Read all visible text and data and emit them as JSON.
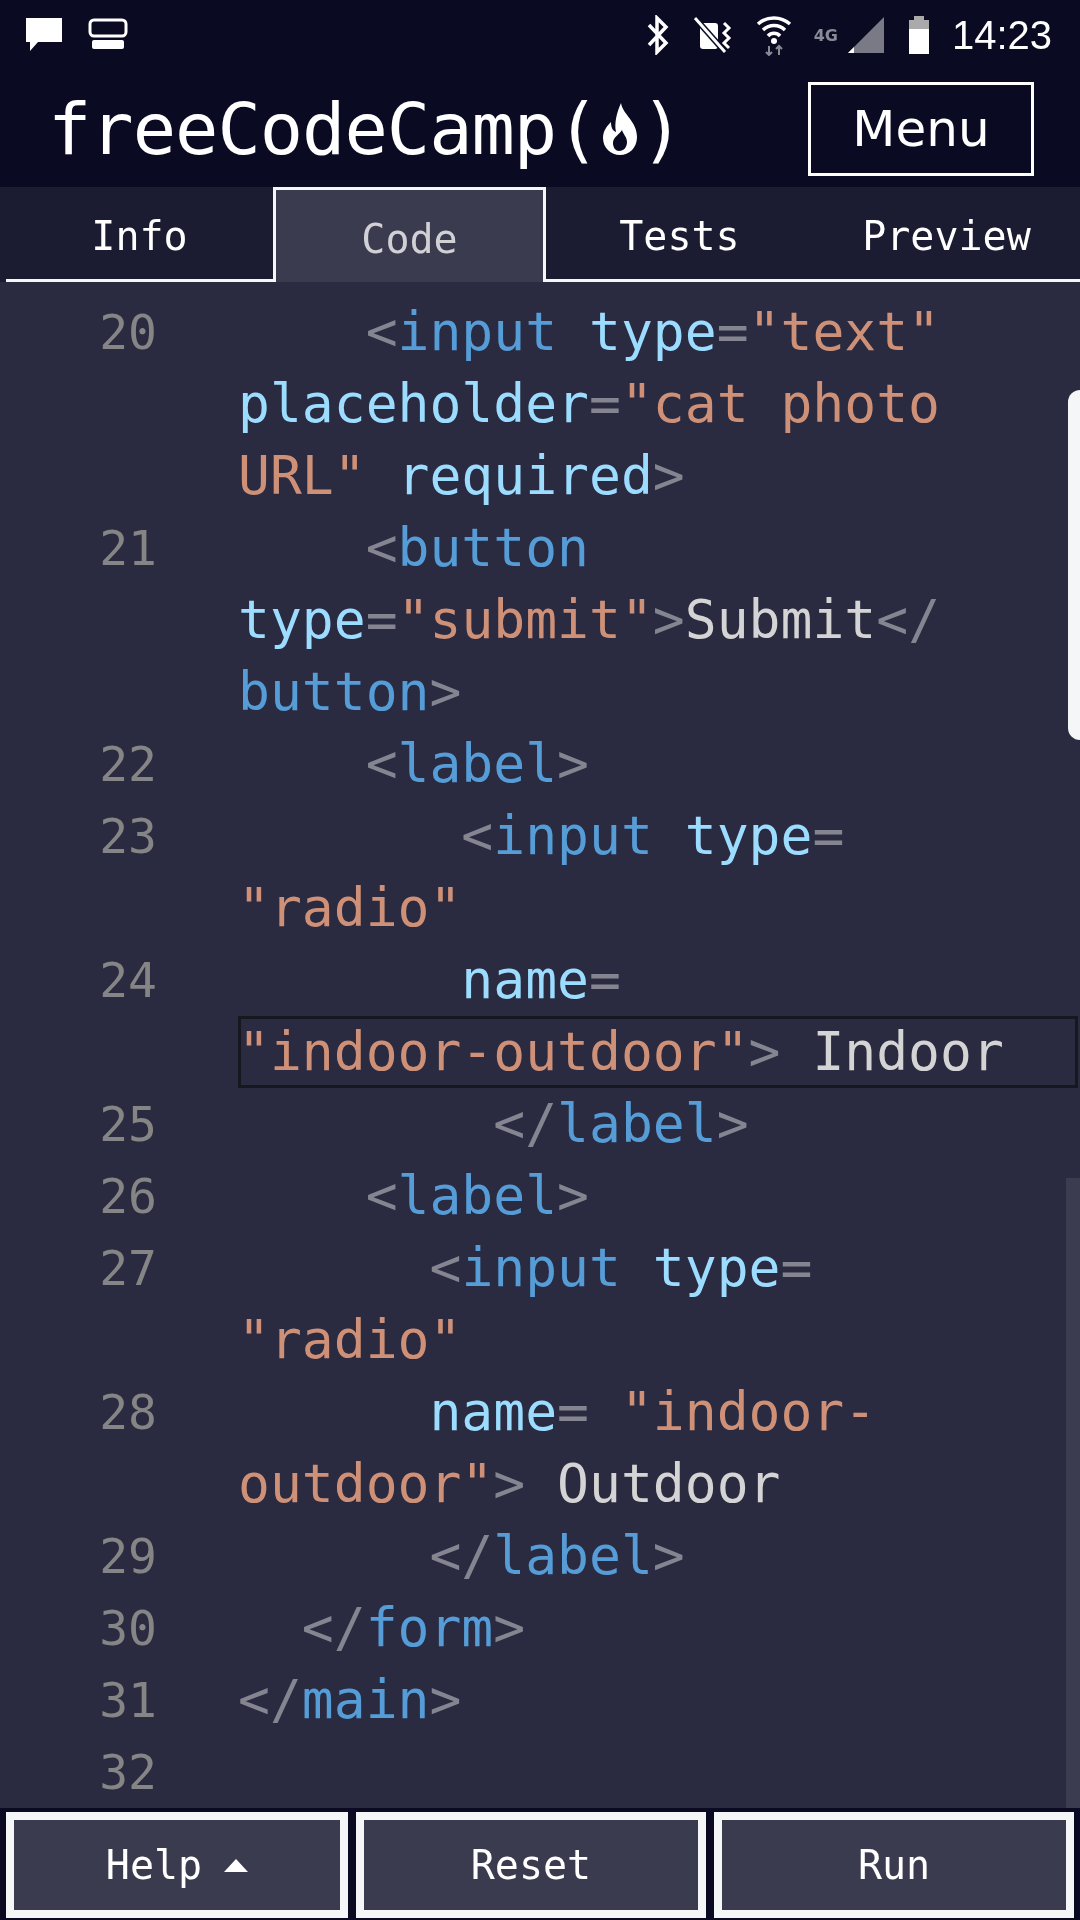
{
  "status_bar": {
    "network": "4G",
    "time": "14:23"
  },
  "header": {
    "brand": "freeCodeCamp",
    "open_paren": "(",
    "close_paren": ")",
    "menu_button": "Menu"
  },
  "tabs": [
    {
      "label": "Info",
      "selected": false
    },
    {
      "label": "Code",
      "selected": true
    },
    {
      "label": "Tests",
      "selected": false
    },
    {
      "label": "Preview",
      "selected": false
    }
  ],
  "editor": {
    "lines": [
      {
        "number": "20",
        "highlighted": false,
        "rows": [
          {
            "tokens": [
              {
                "kind": "punct",
                "text": "    <"
              },
              {
                "kind": "tag",
                "text": "input"
              },
              {
                "kind": "attr",
                "text": " type"
              },
              {
                "kind": "punct",
                "text": "="
              },
              {
                "kind": "string",
                "text": "\"text\""
              }
            ]
          },
          {
            "tokens": [
              {
                "kind": "attr",
                "text": "placeholder"
              },
              {
                "kind": "punct",
                "text": "="
              },
              {
                "kind": "string",
                "text": "\"cat photo"
              }
            ]
          },
          {
            "tokens": [
              {
                "kind": "string",
                "text": "URL\""
              },
              {
                "kind": "attr",
                "text": " required"
              },
              {
                "kind": "punct",
                "text": ">"
              }
            ]
          }
        ]
      },
      {
        "number": "21",
        "highlighted": false,
        "rows": [
          {
            "tokens": [
              {
                "kind": "punct",
                "text": "    <"
              },
              {
                "kind": "tag",
                "text": "button"
              }
            ]
          },
          {
            "tokens": [
              {
                "kind": "attr",
                "text": "type"
              },
              {
                "kind": "punct",
                "text": "="
              },
              {
                "kind": "string",
                "text": "\"submit\""
              },
              {
                "kind": "punct",
                "text": ">"
              },
              {
                "kind": "text",
                "text": "Submit"
              },
              {
                "kind": "punct",
                "text": "</"
              }
            ]
          },
          {
            "tokens": [
              {
                "kind": "tag",
                "text": "button"
              },
              {
                "kind": "punct",
                "text": ">"
              }
            ]
          }
        ]
      },
      {
        "number": "22",
        "highlighted": false,
        "rows": [
          {
            "tokens": [
              {
                "kind": "punct",
                "text": "    <"
              },
              {
                "kind": "tag",
                "text": "label"
              },
              {
                "kind": "punct",
                "text": ">"
              }
            ]
          }
        ]
      },
      {
        "number": "23",
        "highlighted": false,
        "rows": [
          {
            "tokens": [
              {
                "kind": "punct",
                "text": "       <"
              },
              {
                "kind": "tag",
                "text": "input"
              },
              {
                "kind": "attr",
                "text": " type"
              },
              {
                "kind": "punct",
                "text": "="
              }
            ]
          },
          {
            "tokens": [
              {
                "kind": "string",
                "text": "\"radio\""
              }
            ]
          }
        ]
      },
      {
        "number": "24",
        "highlighted": true,
        "rows": [
          {
            "tokens": [
              {
                "kind": "attr",
                "text": "       name"
              },
              {
                "kind": "punct",
                "text": "="
              }
            ]
          },
          {
            "tokens": [
              {
                "kind": "string",
                "text": "\"indoor-outdoor\""
              },
              {
                "kind": "punct",
                "text": ">"
              },
              {
                "kind": "text",
                "text": " Indoor"
              }
            ]
          }
        ]
      },
      {
        "number": "25",
        "highlighted": false,
        "rows": [
          {
            "tokens": [
              {
                "kind": "punct",
                "text": "        </"
              },
              {
                "kind": "tag",
                "text": "label"
              },
              {
                "kind": "punct",
                "text": ">"
              }
            ]
          }
        ]
      },
      {
        "number": "26",
        "highlighted": false,
        "rows": [
          {
            "tokens": [
              {
                "kind": "punct",
                "text": "    <"
              },
              {
                "kind": "tag",
                "text": "label"
              },
              {
                "kind": "punct",
                "text": ">"
              }
            ]
          }
        ]
      },
      {
        "number": "27",
        "highlighted": false,
        "rows": [
          {
            "tokens": [
              {
                "kind": "punct",
                "text": "      <"
              },
              {
                "kind": "tag",
                "text": "input"
              },
              {
                "kind": "attr",
                "text": " type"
              },
              {
                "kind": "punct",
                "text": "="
              }
            ]
          },
          {
            "tokens": [
              {
                "kind": "string",
                "text": "\"radio\""
              }
            ]
          }
        ]
      },
      {
        "number": "28",
        "highlighted": false,
        "rows": [
          {
            "tokens": [
              {
                "kind": "attr",
                "text": "      name"
              },
              {
                "kind": "punct",
                "text": "= "
              },
              {
                "kind": "string",
                "text": "\"indoor-"
              }
            ]
          },
          {
            "tokens": [
              {
                "kind": "string",
                "text": "outdoor\""
              },
              {
                "kind": "punct",
                "text": ">"
              },
              {
                "kind": "text",
                "text": " Outdoor"
              }
            ]
          }
        ]
      },
      {
        "number": "29",
        "highlighted": false,
        "rows": [
          {
            "tokens": [
              {
                "kind": "punct",
                "text": "      </"
              },
              {
                "kind": "tag",
                "text": "label"
              },
              {
                "kind": "punct",
                "text": ">"
              }
            ]
          }
        ]
      },
      {
        "number": "30",
        "highlighted": false,
        "rows": [
          {
            "tokens": [
              {
                "kind": "punct",
                "text": "  </"
              },
              {
                "kind": "tag",
                "text": "form"
              },
              {
                "kind": "punct",
                "text": ">"
              }
            ]
          }
        ]
      },
      {
        "number": "31",
        "highlighted": false,
        "rows": [
          {
            "tokens": [
              {
                "kind": "punct",
                "text": "</"
              },
              {
                "kind": "tag",
                "text": "main"
              },
              {
                "kind": "punct",
                "text": ">"
              }
            ]
          }
        ]
      },
      {
        "number": "32",
        "highlighted": false
      }
    ]
  },
  "actions": [
    {
      "label": "Help",
      "kind": "dropdown"
    },
    {
      "label": "Reset",
      "kind": "plain"
    },
    {
      "label": "Run",
      "kind": "plain"
    }
  ]
}
